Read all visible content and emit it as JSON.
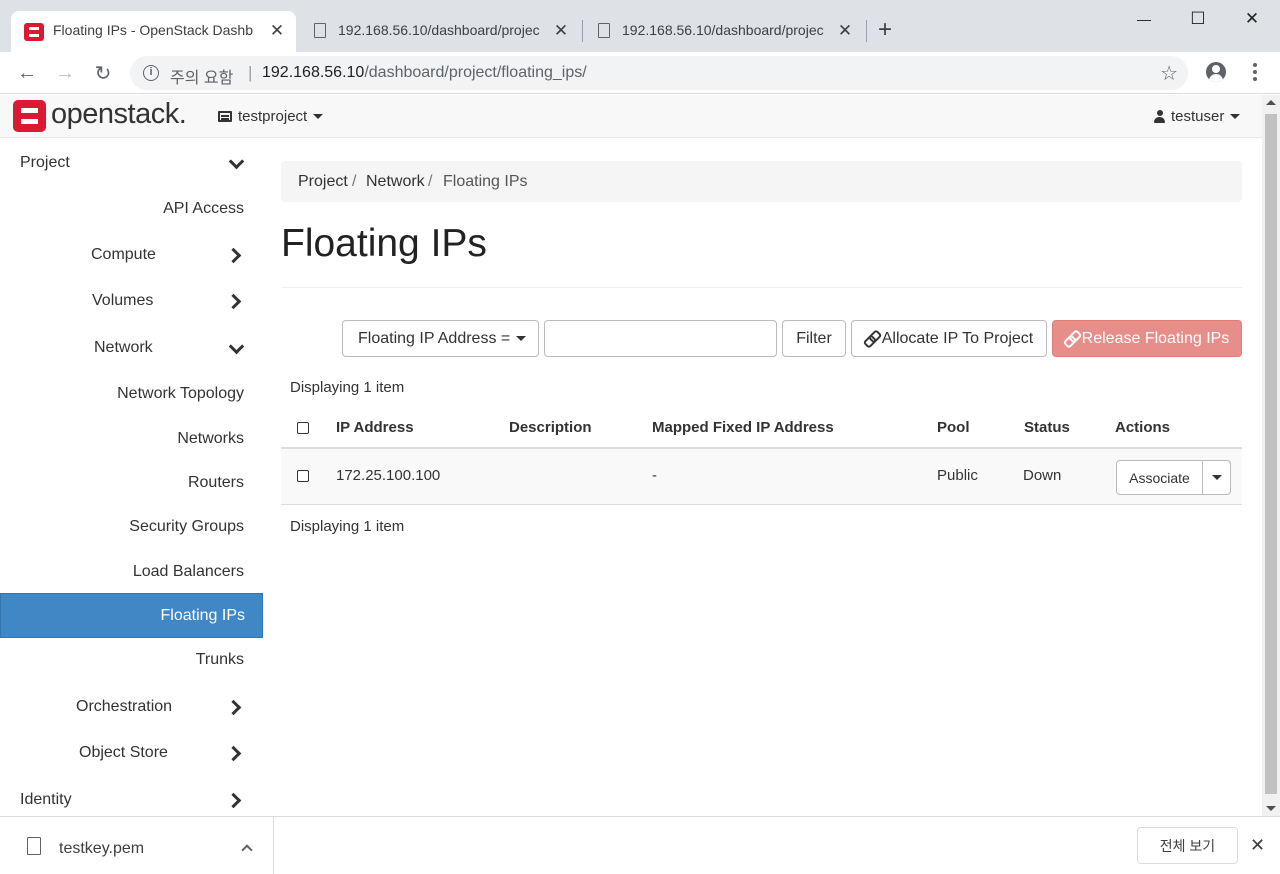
{
  "browser": {
    "tabs": [
      {
        "title": "Floating IPs - OpenStack Dashb",
        "icon": "openstack-logo-icon",
        "active": true
      },
      {
        "title": "192.168.56.10/dashboard/projec",
        "icon": "page-icon",
        "active": false
      },
      {
        "title": "192.168.56.10/dashboard/projec",
        "icon": "page-icon",
        "active": false
      }
    ],
    "tab_close_glyph": "✕",
    "new_tab_glyph": "+",
    "window_controls": {
      "minimize": "—",
      "maximize": "☐",
      "close": "✕"
    },
    "nav": {
      "back": "←",
      "forward": "→",
      "reload": "↻"
    },
    "omnibox": {
      "security_label": "주의 요함",
      "separator": "|",
      "url_host": "192.168.56.10",
      "url_path": "/dashboard/project/floating_ips/",
      "star_glyph": "☆"
    }
  },
  "header": {
    "brand": "openstack.",
    "project": "testproject",
    "user": "testuser"
  },
  "sidebar": {
    "items": [
      {
        "label": "Project",
        "chevron": "down"
      },
      {
        "label": "API Access"
      },
      {
        "label": "Compute",
        "chevron": "right"
      },
      {
        "label": "Volumes",
        "chevron": "right"
      },
      {
        "label": "Network",
        "chevron": "down"
      },
      {
        "label": "Network Topology"
      },
      {
        "label": "Networks"
      },
      {
        "label": "Routers"
      },
      {
        "label": "Security Groups"
      },
      {
        "label": "Load Balancers"
      },
      {
        "label": "Floating IPs",
        "active": true
      },
      {
        "label": "Trunks"
      },
      {
        "label": "Orchestration",
        "chevron": "right"
      },
      {
        "label": "Object Store",
        "chevron": "right"
      },
      {
        "label": "Identity",
        "chevron": "right"
      }
    ]
  },
  "breadcrumb": {
    "items": [
      "Project",
      "Network",
      "Floating IPs"
    ],
    "separator": "/"
  },
  "page_title": "Floating IPs",
  "filter": {
    "field_label": "Floating IP Address =",
    "input_value": "",
    "filter_button": "Filter",
    "allocate_button": "Allocate IP To Project",
    "release_button": "Release Floating IPs"
  },
  "table": {
    "count_text": "Displaying 1 item",
    "columns": [
      "IP Address",
      "Description",
      "Mapped Fixed IP Address",
      "Pool",
      "Status",
      "Actions"
    ],
    "rows": [
      {
        "ip_address": "172.25.100.100",
        "description": "",
        "mapped_fixed_ip": "-",
        "pool": "Public",
        "status": "Down",
        "action": "Associate"
      }
    ]
  },
  "downloads": {
    "file_name": "testkey.pem",
    "show_all": "전체 보기",
    "close_glyph": "✕"
  },
  "colors": {
    "brand_red": "#da1a32",
    "active_nav": "#3f88c5",
    "danger_disabled": "#e88e8a"
  }
}
